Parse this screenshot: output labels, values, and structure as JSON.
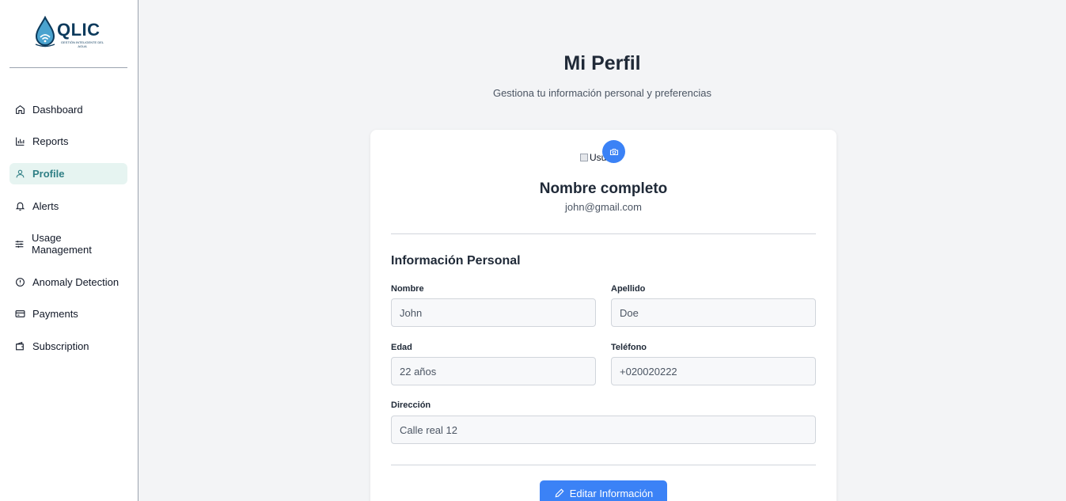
{
  "brand": {
    "name": "QLIC",
    "tagline": "GESTIÓN INTELIGENTE DEL AGUA",
    "color": "#0c3a5c"
  },
  "sidebar": {
    "items": [
      {
        "label": "Dashboard",
        "icon": "home-icon",
        "active": false
      },
      {
        "label": "Reports",
        "icon": "bar-chart-icon",
        "active": false
      },
      {
        "label": "Profile",
        "icon": "user-icon",
        "active": true
      },
      {
        "label": "Alerts",
        "icon": "bell-icon",
        "active": false
      },
      {
        "label": "Usage Management",
        "icon": "sliders-icon",
        "active": false
      },
      {
        "label": "Anomaly Detection",
        "icon": "alert-circle-icon",
        "active": false
      },
      {
        "label": "Payments",
        "icon": "credit-card-icon",
        "active": false
      },
      {
        "label": "Subscription",
        "icon": "wallet-icon",
        "active": false
      }
    ]
  },
  "header": {
    "title": "Mi Perfil",
    "subtitle": "Gestiona tu información personal y preferencias"
  },
  "profile": {
    "avatar_alt": "Usuario",
    "full_name": "Nombre completo",
    "email": "john@gmail.com"
  },
  "personal_info": {
    "section_title": "Información Personal",
    "fields": {
      "nombre": {
        "label": "Nombre",
        "value": "John"
      },
      "apellido": {
        "label": "Apellido",
        "value": "Doe"
      },
      "edad": {
        "label": "Edad",
        "value": "22 años"
      },
      "telefono": {
        "label": "Teléfono",
        "value": "+020020222"
      },
      "direccion": {
        "label": "Dirección",
        "value": "Calle real 12"
      }
    }
  },
  "actions": {
    "edit_label": "Editar Información"
  },
  "colors": {
    "accent": "#3b82f6",
    "active_nav_bg": "#e6f4f1",
    "active_nav_text": "#2f7f85"
  }
}
